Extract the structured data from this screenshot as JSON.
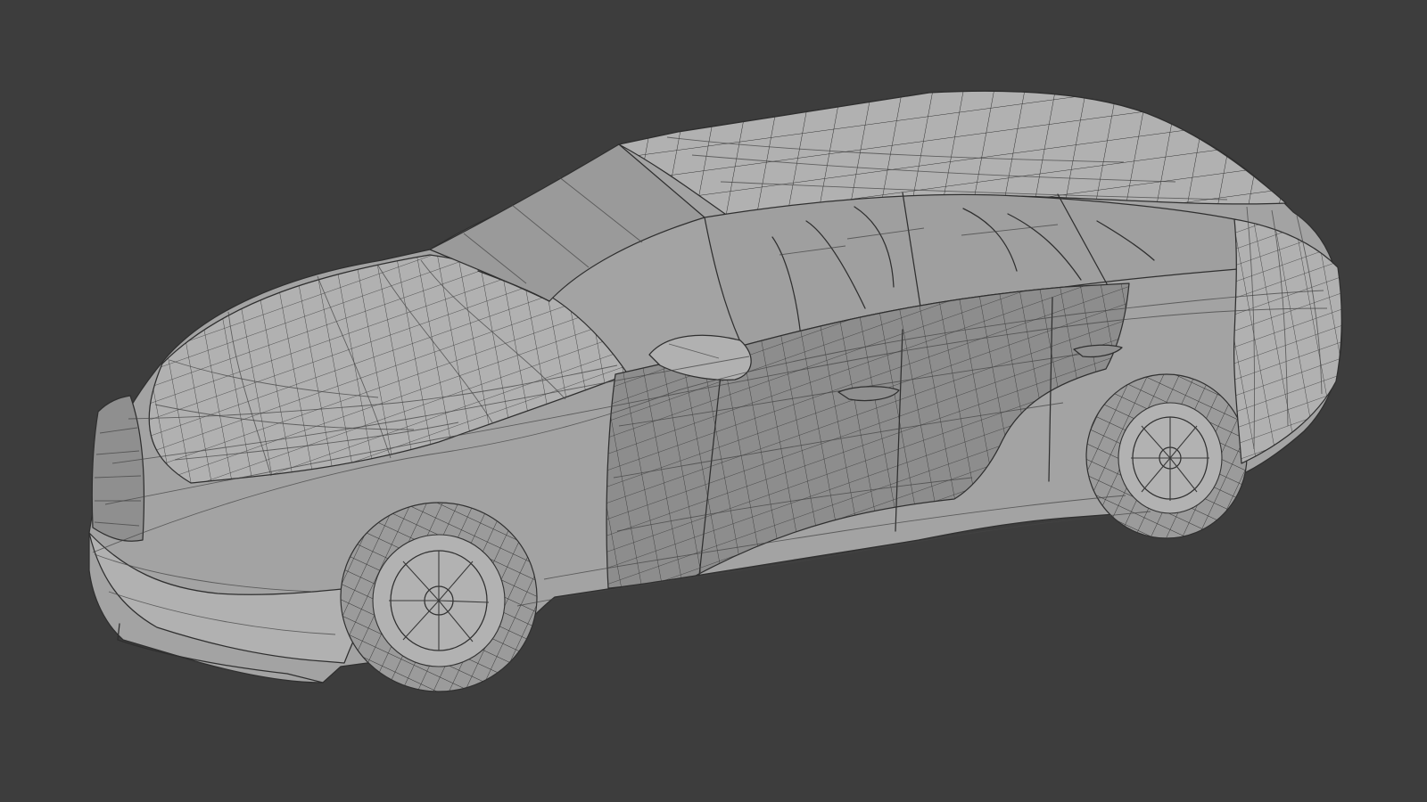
{
  "scene": {
    "background_color": "#3d3d3d",
    "mesh_color": "#a3a3a3",
    "wire_color": "#2f2f2f",
    "subject": "car-wireframe-mesh"
  }
}
